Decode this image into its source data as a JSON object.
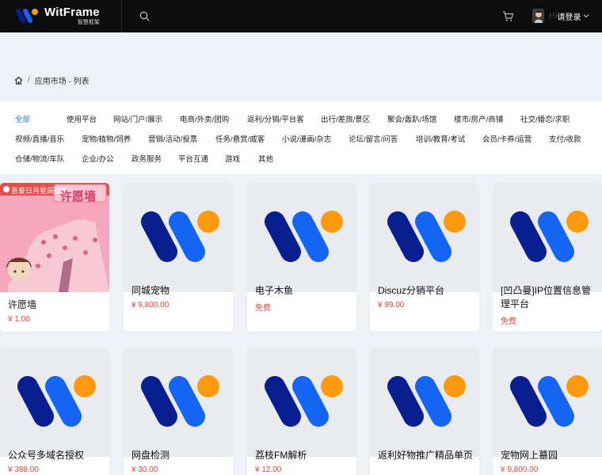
{
  "brand": {
    "name": "WitFrame",
    "tagline": "智慧框架"
  },
  "user": {
    "greeting": "Hi",
    "login_label": "请登录"
  },
  "breadcrumb": {
    "home_icon": "home-icon",
    "section": "应用市场 - 列表"
  },
  "categories": [
    "全部",
    "使用平台",
    "网站/门户/展示",
    "电商/外卖/团购",
    "返利/分销/平台客",
    "出行/差旅/景区",
    "聚会/轰趴/场馆",
    "楼市/房产/商铺",
    "社交/婚恋/求职",
    "视频/直播/音乐",
    "宠物/植物/饲养",
    "营销/活动/投票",
    "任务/悬赏/威客",
    "小说/漫画/杂志",
    "论坛/留言/问答",
    "培训/教育/考试",
    "会员/卡券/运营",
    "支付/收款",
    "仓储/物流/车队",
    "企业/办公",
    "政务服务",
    "平台互通",
    "游戏",
    "其他"
  ],
  "active_category": "全部",
  "products": [
    {
      "title": "许愿墙",
      "price": "¥ 1.00",
      "image": "wishing-wall",
      "banner": "吾爱日月星辰软件",
      "heading": "许愿墙"
    },
    {
      "title": "同城宠物",
      "price": "¥ 9,800.00",
      "image": "witframe-logo"
    },
    {
      "title": "电子木鱼",
      "price": "免费",
      "image": "witframe-logo"
    },
    {
      "title": "Discuz分销平台",
      "price": "¥ 99.00",
      "image": "witframe-logo"
    },
    {
      "title": "[凹凸曼]IP位置信息管理平台",
      "price": "免费",
      "image": "witframe-logo"
    },
    {
      "title": "公众号多域名授权",
      "price": "¥ 388.00",
      "image": "witframe-logo"
    },
    {
      "title": "网盘检测",
      "price": "¥ 30.00",
      "image": "witframe-logo"
    },
    {
      "title": "荔枝FM解析",
      "price": "¥ 12.00",
      "image": "witframe-logo"
    },
    {
      "title": "返利好物推广精品单页",
      "price": "",
      "image": "witframe-logo"
    },
    {
      "title": "宠物网上墓园",
      "price": "¥ 9,800.00",
      "image": "witframe-logo"
    }
  ],
  "colors": {
    "topbar": "#0c0c0c",
    "accent": "#2b6fe6",
    "price": "#e2433c",
    "logo_dark": "#0a1f8f",
    "logo_blue": "#1565f5",
    "logo_orange": "#ff9a0e"
  }
}
